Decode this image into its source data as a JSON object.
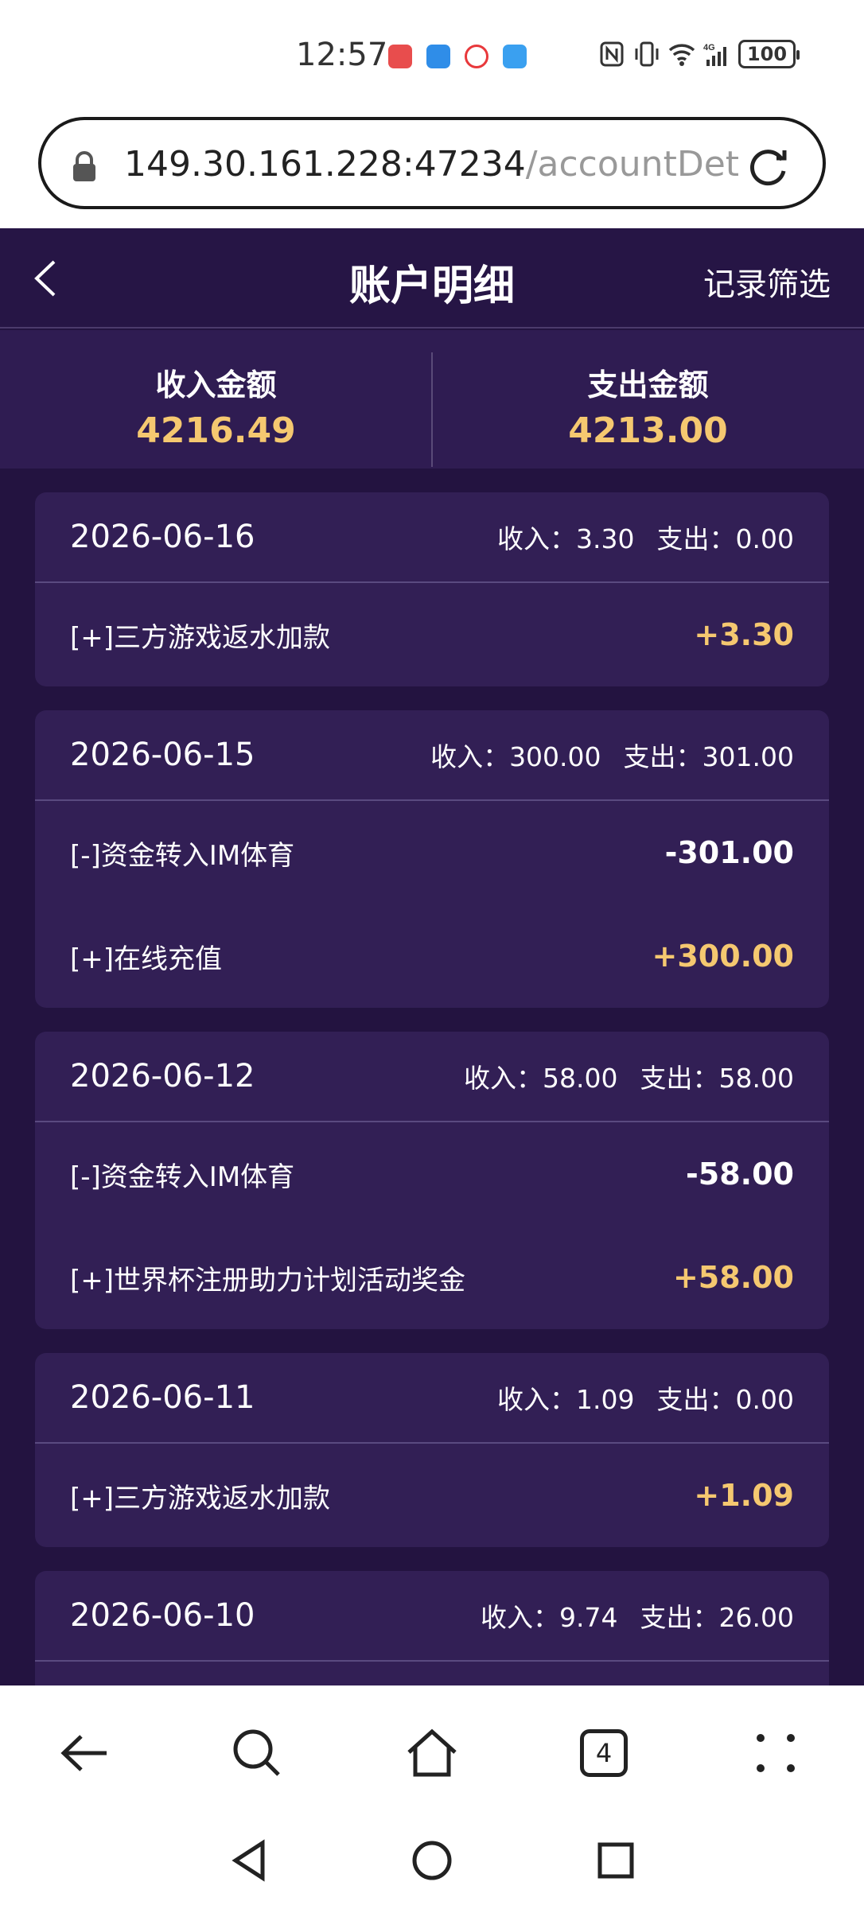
{
  "status_bar": {
    "time": "12:57",
    "battery": "100",
    "icons": [
      "nfc-icon",
      "vibrate-icon",
      "wifi-icon",
      "signal-4g-icon"
    ],
    "apps": [
      {
        "name": "notes-app-icon",
        "color": "#e84d4d"
      },
      {
        "name": "alipay-app-icon",
        "color": "#2f8de8"
      },
      {
        "name": "weibo-app-icon",
        "color": "#e8383b"
      },
      {
        "name": "weather-app-icon",
        "color": "#3aa0f0"
      }
    ]
  },
  "browser": {
    "url_host": "149.30.161.228:47234",
    "url_path": "/accountDet",
    "tabs_count": "4"
  },
  "header": {
    "title": "账户明细",
    "filter_label": "记录筛选"
  },
  "summary": {
    "income_label": "收入金额",
    "income_value": "4216.49",
    "expense_label": "支出金额",
    "expense_value": "4213.00"
  },
  "days": [
    {
      "date": "2026-06-16",
      "income": "收入：3.30",
      "expense": "支出：0.00",
      "entries": [
        {
          "desc": "[+]三方游戏返水加款",
          "amount": "+3.30",
          "type": "pos"
        }
      ]
    },
    {
      "date": "2026-06-15",
      "income": "收入：300.00",
      "expense": "支出：301.00",
      "entries": [
        {
          "desc": "[-]资金转入IM体育",
          "amount": "-301.00",
          "type": "neg"
        },
        {
          "desc": "[+]在线充值",
          "amount": "+300.00",
          "type": "pos"
        }
      ]
    },
    {
      "date": "2026-06-12",
      "income": "收入：58.00",
      "expense": "支出：58.00",
      "entries": [
        {
          "desc": "[-]资金转入IM体育",
          "amount": "-58.00",
          "type": "neg"
        },
        {
          "desc": "[+]世界杯注册助力计划活动奖金",
          "amount": "+58.00",
          "type": "pos"
        }
      ]
    },
    {
      "date": "2026-06-11",
      "income": "收入：1.09",
      "expense": "支出：0.00",
      "entries": [
        {
          "desc": "[+]三方游戏返水加款",
          "amount": "+1.09",
          "type": "pos"
        }
      ]
    },
    {
      "date": "2026-06-10",
      "income": "收入：9.74",
      "expense": "支出：26.00",
      "entries": []
    }
  ]
}
